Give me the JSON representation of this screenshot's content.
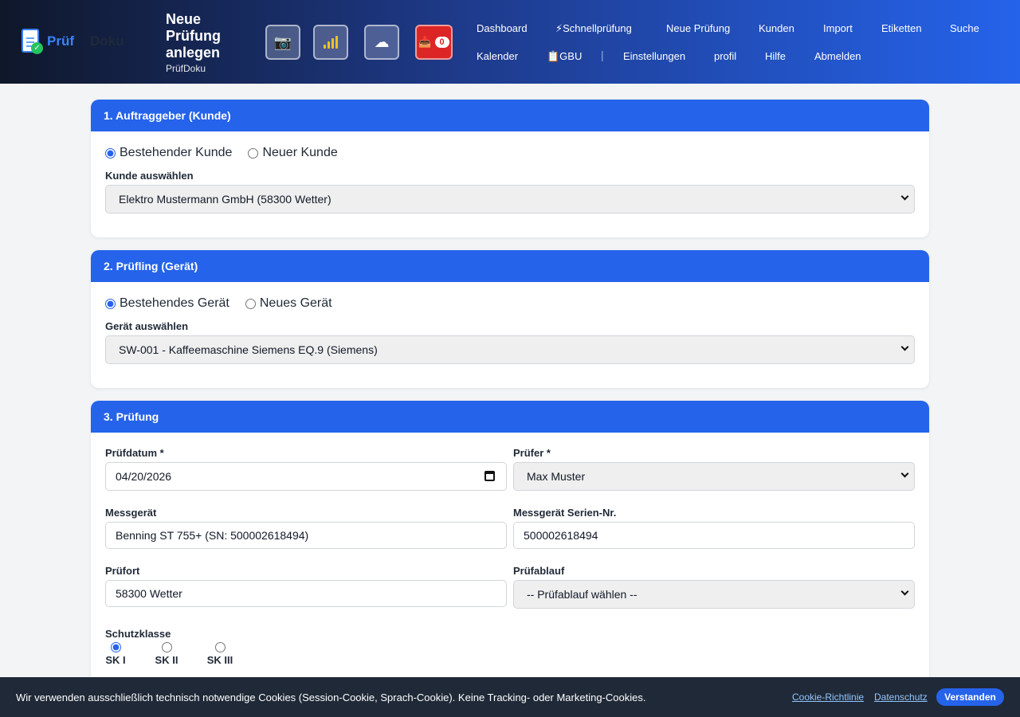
{
  "app": {
    "logo_part1": "Prüf",
    "logo_part2": "Doku"
  },
  "header": {
    "title": "Neue Prüfung anlegen",
    "subtitle": "PrüfDoku",
    "camera_icon": "📷",
    "cloud_icon": "☁",
    "inbox_icon": "📥",
    "inbox_count": "0"
  },
  "nav": {
    "dashboard": "Dashboard",
    "schnell": "⚡Schnellprüfung",
    "neue": "Neue Prüfung",
    "kunden": "Kunden",
    "import": "Import",
    "etiketten": "Etiketten",
    "suche": "Suche",
    "kalender": "Kalender",
    "gbu": "📋GBU",
    "separator": "|",
    "einstellungen": "Einstellungen",
    "profil": "profil",
    "hilfe": "Hilfe",
    "abmelden": "Abmelden"
  },
  "section1": {
    "title": "1. Auftraggeber (Kunde)",
    "radio_existing": "Bestehender Kunde",
    "radio_new": "Neuer Kunde",
    "select_label": "Kunde auswählen",
    "select_value": "Elektro Mustermann GmbH (58300 Wetter)"
  },
  "section2": {
    "title": "2. Prüfling (Gerät)",
    "radio_existing": "Bestehendes Gerät",
    "radio_new": "Neues Gerät",
    "select_label": "Gerät auswählen",
    "select_value": "SW-001 - Kaffeemaschine Siemens EQ.9 (Siemens)"
  },
  "section3": {
    "title": "3. Prüfung",
    "pruefdatum_label": "Prüfdatum *",
    "pruefdatum_value": "04/20/2026",
    "pruefer_label": "Prüfer *",
    "pruefer_value": "Max Muster",
    "messgeraet_label": "Messgerät",
    "messgeraet_value": "Benning ST 755+ (SN: 500002618494)",
    "seriennr_label": "Messgerät Serien-Nr.",
    "seriennr_value": "500002618494",
    "pruefort_label": "Prüfort",
    "pruefort_value": "58300 Wetter",
    "pruefablauf_label": "Prüfablauf",
    "pruefablauf_value": "-- Prüfablauf wählen --",
    "schutzklasse_label": "Schutzklasse",
    "schutzklassen": [
      "SK I",
      "SK II",
      "SK III"
    ],
    "schutzklasse_selected": "SK I"
  },
  "cookie": {
    "message": "Wir verwenden ausschließlich technisch notwendige Cookies (Session-Cookie, Sprach-Cookie). Keine Tracking- oder Marketing-Cookies.",
    "policy_link": "Cookie-Richtlinie",
    "privacy_link": "Datenschutz",
    "accept_button": "Verstanden"
  },
  "colors": {
    "primary": "#2563eb",
    "danger": "#dc2626",
    "header_dark": "#0f172a",
    "cookie_bg": "#1f2937"
  }
}
